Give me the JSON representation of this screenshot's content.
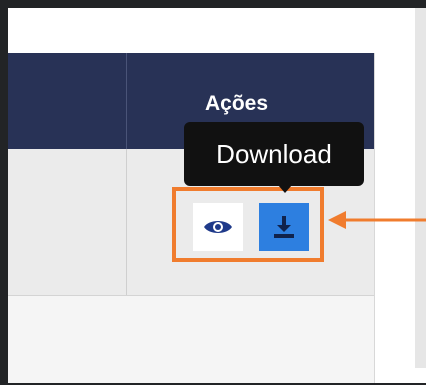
{
  "table": {
    "header": {
      "actions_label": "Ações"
    },
    "row": {
      "actions": {
        "view_icon": "eye-icon",
        "download_icon": "download-icon"
      }
    }
  },
  "tooltip": {
    "text": "Download"
  },
  "colors": {
    "header_bg": "#283256",
    "download_button": "#2d7fe0",
    "highlight": "#f07c2e",
    "tooltip_bg": "#111111"
  }
}
